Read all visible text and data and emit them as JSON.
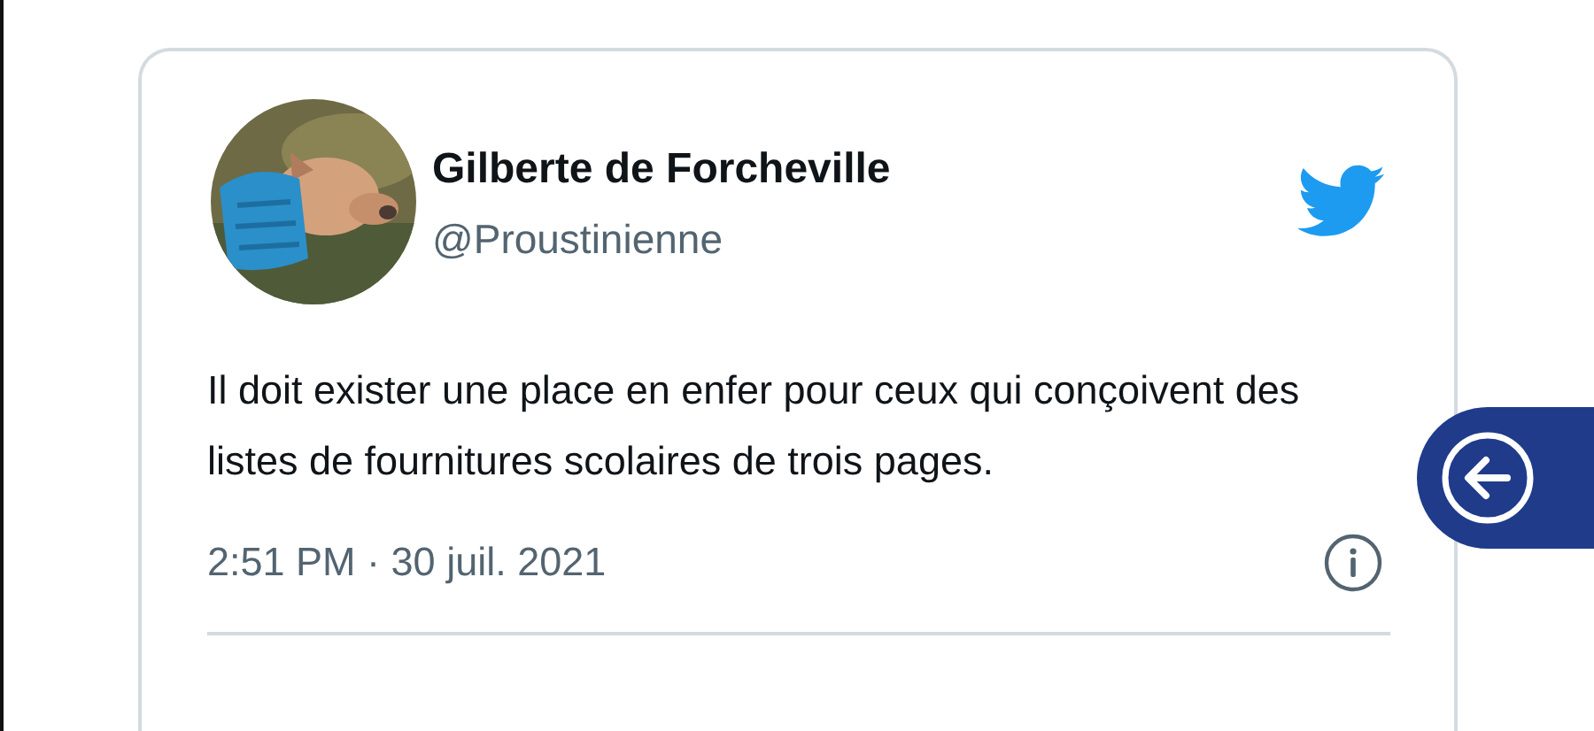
{
  "tweet": {
    "author_name": "Gilberte de Forcheville",
    "handle": "@Proustinienne",
    "text": "Il doit exister une place en enfer pour ceux qui conçoivent des listes de fournitures scolaires de trois pages.",
    "timestamp": "2:51 PM · 30 juil. 2021"
  }
}
